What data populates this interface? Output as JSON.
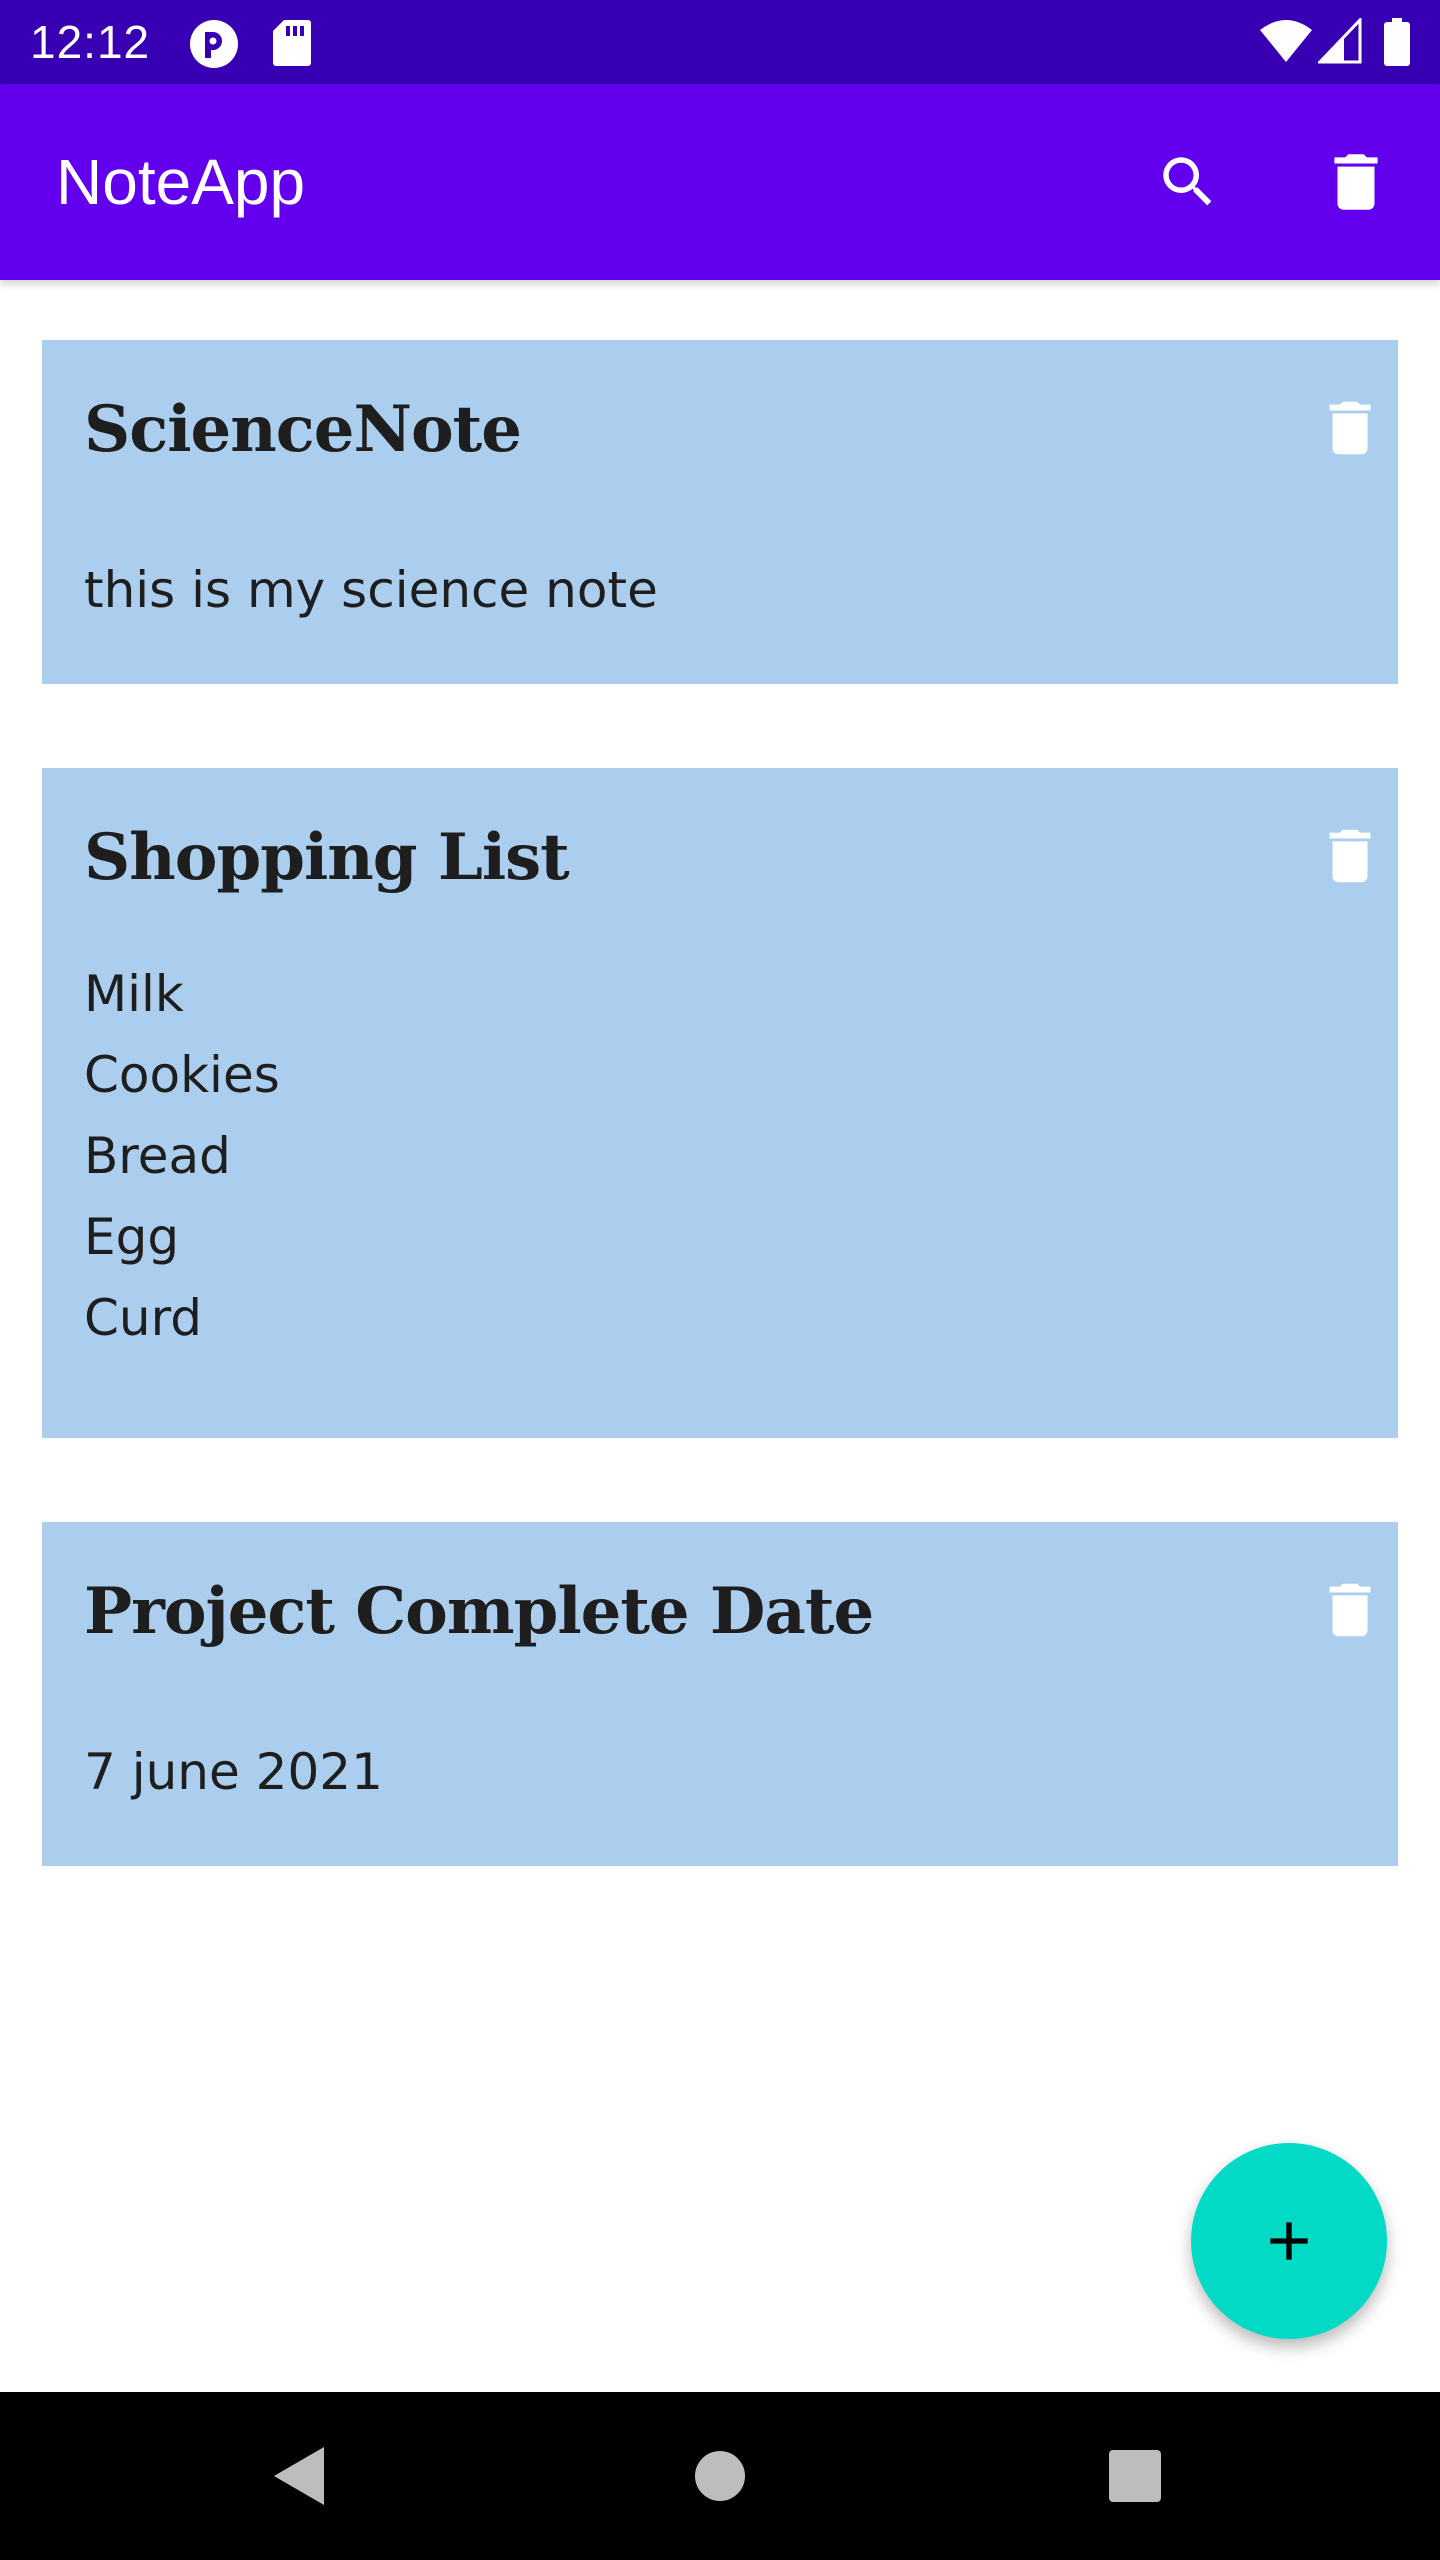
{
  "status_bar": {
    "time": "12:12",
    "icons": [
      "app-notification-icon",
      "sd-card-icon",
      "wifi-icon",
      "cell-signal-icon",
      "battery-icon"
    ]
  },
  "app_bar": {
    "title": "NoteApp",
    "actions": [
      "search-icon",
      "delete-all-icon"
    ]
  },
  "notes": [
    {
      "title": "ScienceNote",
      "body": "this is my science note"
    },
    {
      "title": "Shopping List",
      "body": "Milk\nCookies\nBread\nEgg\nCurd"
    },
    {
      "title": "Project Complete Date",
      "body": "7 june 2021"
    }
  ],
  "fab": {
    "icon": "add-icon"
  },
  "nav_bar": {
    "buttons": [
      "back-icon",
      "home-icon",
      "recents-icon"
    ]
  },
  "colors": {
    "status_bar": "#3700b3",
    "app_bar": "#6200ee",
    "card_background": "#abcdee",
    "fab": "#03dac5"
  }
}
